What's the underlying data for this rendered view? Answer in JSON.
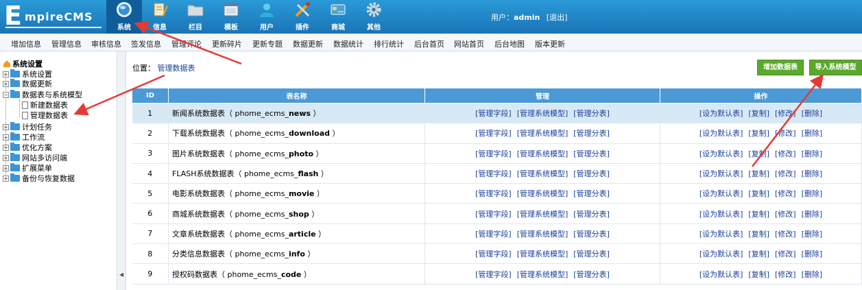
{
  "logo": {
    "first": "E",
    "rest": "mpireCMS"
  },
  "nav": [
    {
      "label": "系统",
      "icon": "globe-icon",
      "active": true
    },
    {
      "label": "信息",
      "icon": "pencil-note-icon"
    },
    {
      "label": "栏目",
      "icon": "folder-icon"
    },
    {
      "label": "模板",
      "icon": "window-icon"
    },
    {
      "label": "用户",
      "icon": "user-icon"
    },
    {
      "label": "插件",
      "icon": "tools-icon"
    },
    {
      "label": "商城",
      "icon": "card-icon"
    },
    {
      "label": "其他",
      "icon": "gear-icon"
    }
  ],
  "user": {
    "prefix": "用户：",
    "name": "admin",
    "logout": "[退出]"
  },
  "subnav": [
    "增加信息",
    "管理信息",
    "审核信息",
    "签发信息",
    "管理评论",
    "更新碎片",
    "更新专题",
    "数据更新",
    "数据统计",
    "排行统计",
    "后台首页",
    "网站首页",
    "后台地图",
    "版本更新"
  ],
  "sidebar": {
    "root": "系统设置",
    "items": [
      "系统设置",
      "数据更新",
      "数据表与系统模型"
    ],
    "children": [
      "新建数据表",
      "管理数据表"
    ],
    "more": [
      "计划任务",
      "工作流",
      "优化方案",
      "网站多访问端",
      "扩展菜单",
      "备份与恢复数据"
    ]
  },
  "breadcrumb": {
    "label": "位置：",
    "link": "管理数据表"
  },
  "buttons": {
    "add_table": "增加数据表",
    "import_model": "导入系统模型"
  },
  "table": {
    "headers": {
      "id": "ID",
      "name": "表名称",
      "manage": "管理",
      "ops": "操作"
    },
    "manage_links": [
      "[管理字段]",
      "[管理系统模型]",
      "[管理分表]"
    ],
    "op_links": [
      "[设为默认表]",
      "[复制]",
      "[修改]",
      "[删除]"
    ],
    "rows": [
      {
        "id": "1",
        "label": "新闻系统数据表",
        "prefix": "（ phome_ecms_",
        "tbl": "news",
        "suffix": " ）"
      },
      {
        "id": "2",
        "label": "下载系统数据表",
        "prefix": "（ phome_ecms_",
        "tbl": "download",
        "suffix": " ）"
      },
      {
        "id": "3",
        "label": "图片系统数据表",
        "prefix": "（ phome_ecms_",
        "tbl": "photo",
        "suffix": " ）"
      },
      {
        "id": "4",
        "label": "FLASH系统数据表",
        "prefix": "（ phome_ecms_",
        "tbl": "flash",
        "suffix": " ）"
      },
      {
        "id": "5",
        "label": "电影系统数据表",
        "prefix": "（ phome_ecms_",
        "tbl": "movie",
        "suffix": " ）"
      },
      {
        "id": "6",
        "label": "商城系统数据表",
        "prefix": "（ phome_ecms_",
        "tbl": "shop",
        "suffix": " ）"
      },
      {
        "id": "7",
        "label": "文章系统数据表",
        "prefix": "（ phome_ecms_",
        "tbl": "article",
        "suffix": " ）"
      },
      {
        "id": "8",
        "label": "分类信息数据表",
        "prefix": "（ phome_ecms_",
        "tbl": "info",
        "suffix": " ）"
      },
      {
        "id": "9",
        "label": "授权码数据表",
        "prefix": "（ phome_ecms_",
        "tbl": "code",
        "suffix": " ）"
      }
    ]
  },
  "colors": {
    "topbar": "#1a74b6",
    "header": "#4b9ad6",
    "button": "#5ba92c",
    "arrow": "#e53935"
  }
}
